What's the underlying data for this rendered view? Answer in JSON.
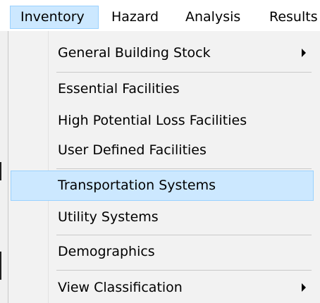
{
  "menubar": {
    "items": [
      {
        "label": "Inventory",
        "active": true
      },
      {
        "label": "Hazard",
        "active": false
      },
      {
        "label": "Analysis",
        "active": false
      },
      {
        "label": "Results",
        "active": false
      }
    ]
  },
  "dropdown": {
    "items": [
      {
        "label": "General Building Stock",
        "submenu": true,
        "submenu_icon": "chevron-right-icon"
      },
      {
        "label": "Essential Facilities",
        "submenu": false
      },
      {
        "label": "High Potential Loss Facilities",
        "submenu": false
      },
      {
        "label": "User Defined Facilities",
        "submenu": false
      },
      {
        "label": "Transportation Systems",
        "submenu": false,
        "highlighted": true
      },
      {
        "label": "Utility Systems",
        "submenu": false
      },
      {
        "label": "Demographics",
        "submenu": false
      },
      {
        "label": "View Classification",
        "submenu": true,
        "submenu_icon": "chevron-right-icon"
      }
    ]
  },
  "colors": {
    "highlight_fill": "#cce8ff",
    "highlight_border": "#99d1ff",
    "menu_background": "#f2f2f2",
    "separator": "#c9c9c9"
  }
}
